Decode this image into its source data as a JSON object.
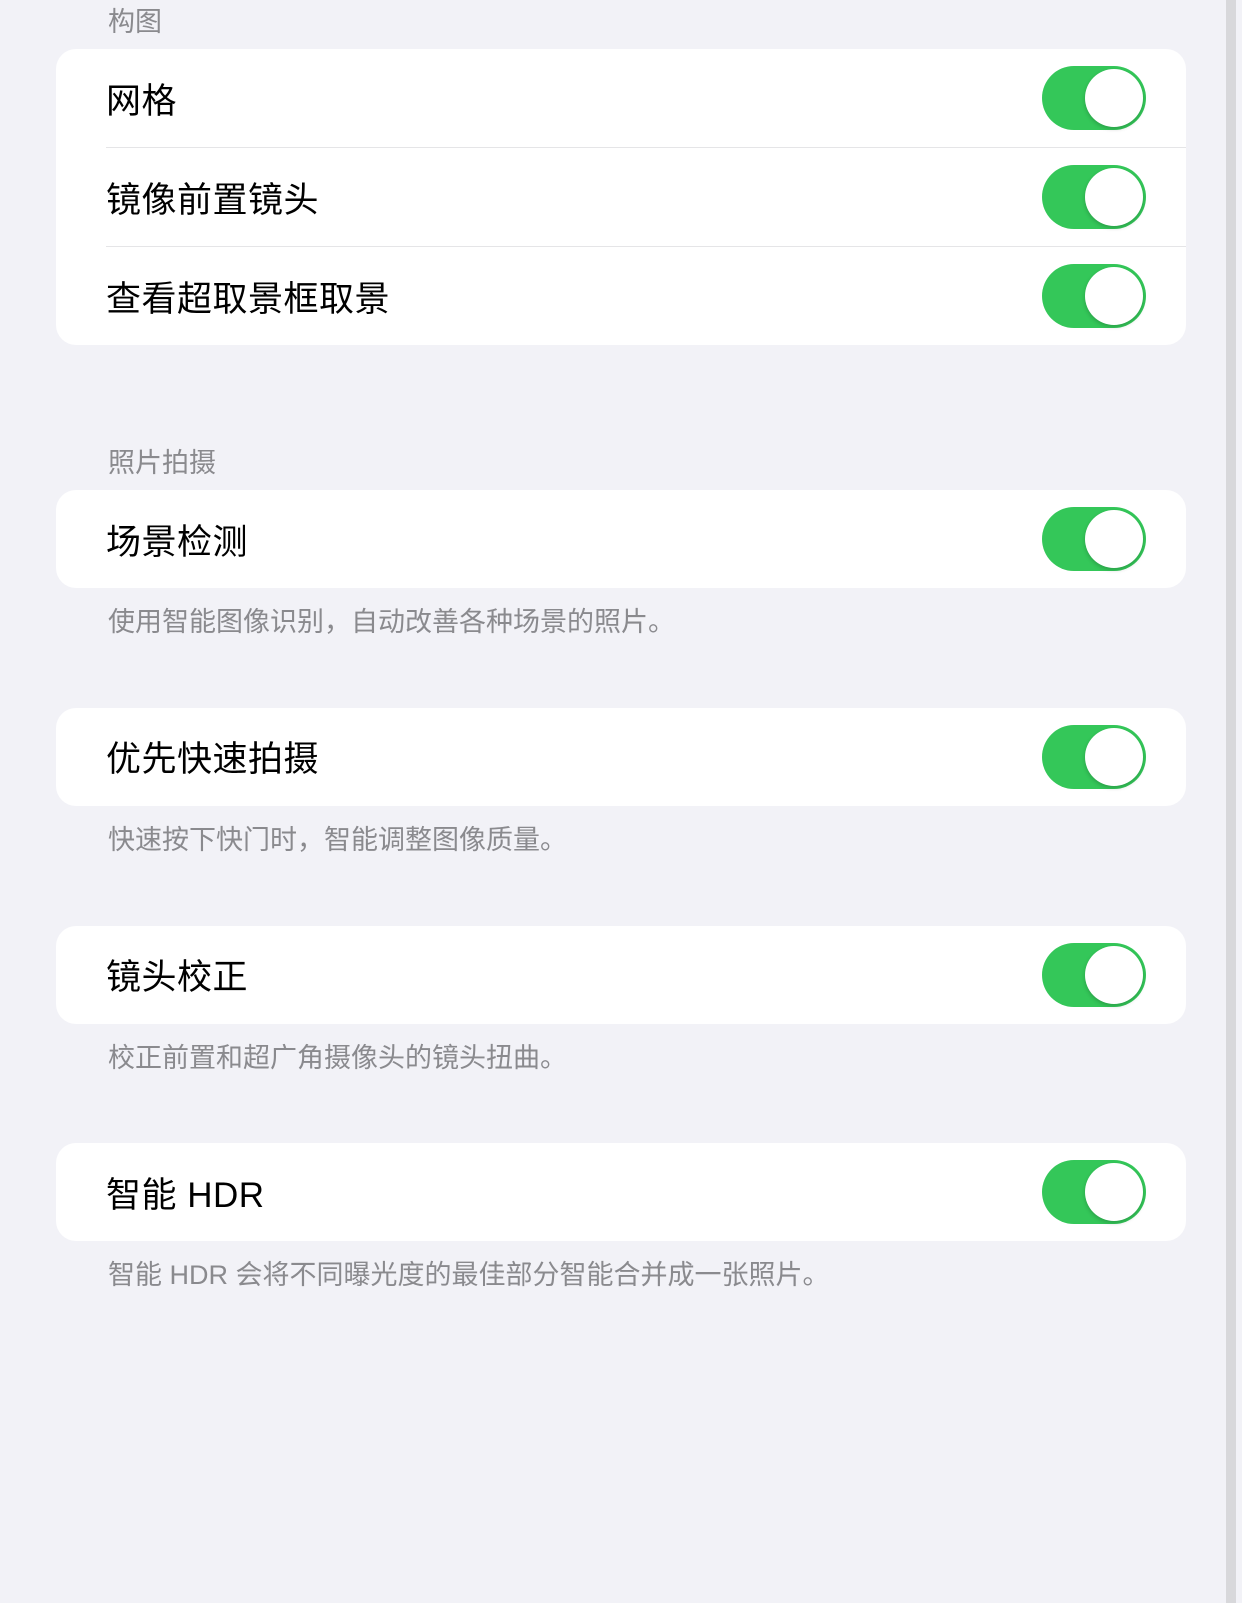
{
  "sections": {
    "composition": {
      "header": "构图",
      "items": {
        "grid": {
          "label": "网格",
          "on": true
        },
        "mirror_front": {
          "label": "镜像前置镜头",
          "on": true
        },
        "view_outside_frame": {
          "label": "查看超取景框取景",
          "on": true
        }
      }
    },
    "photo_capture": {
      "header": "照片拍摄",
      "items": {
        "scene_detection": {
          "label": "场景检测",
          "on": true,
          "footer": "使用智能图像识别，自动改善各种场景的照片。"
        },
        "prioritize_faster": {
          "label": "优先快速拍摄",
          "on": true,
          "footer": "快速按下快门时，智能调整图像质量。"
        },
        "lens_correction": {
          "label": "镜头校正",
          "on": true,
          "footer": "校正前置和超广角摄像头的镜头扭曲。"
        },
        "smart_hdr": {
          "label": "智能 HDR",
          "on": true,
          "footer": "智能 HDR 会将不同曝光度的最佳部分智能合并成一张照片。"
        }
      }
    }
  },
  "colors": {
    "toggle_on": "#34c759",
    "background": "#f2f2f7",
    "row_bg": "#ffffff",
    "text_primary": "#000000",
    "text_secondary": "#8a8a8e"
  }
}
